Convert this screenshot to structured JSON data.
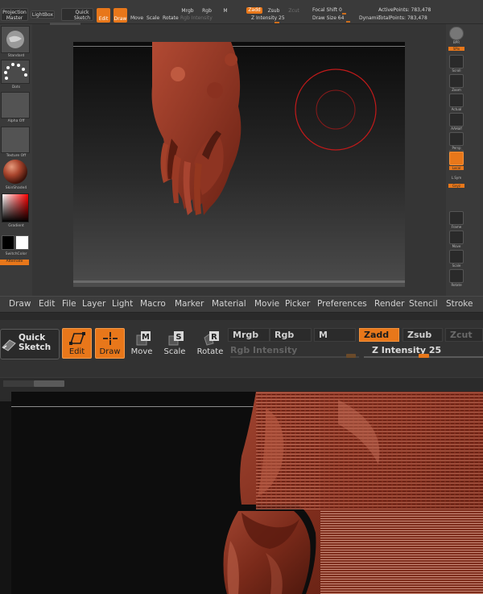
{
  "mini": {
    "toolbar": {
      "projection_master": "Projection Master",
      "lightbox": "LightBox",
      "quick_sketch": "Quick Sketch",
      "edit": "Edit",
      "draw": "Draw",
      "move": "Move",
      "scale": "Scale",
      "rotate": "Rotate",
      "mrgb": "Mrgb",
      "rgb": "Rgb",
      "m": "M",
      "rgb_intensity": "Rgb Intensity",
      "zadd": "Zadd",
      "zsub": "Zsub",
      "zcut": "Zcut",
      "z_intensity": "Z Intensity 25",
      "focal_shift": "Focal Shift 0",
      "draw_size": "Draw Size 64",
      "dynamic": "Dynamic",
      "active_points": "ActivePoints: 783,478",
      "total_points": "TotalPoints: 783,478"
    },
    "left": {
      "brush_label": "Standard",
      "stroke_label": "Dots",
      "alpha_label": "Alpha Off",
      "texture_label": "Texture Off",
      "material_label": "SkinShade4",
      "gradient_label": "Gradient",
      "switch_color": "SwitchColor",
      "alternate": "Alternate"
    },
    "right": {
      "buttons": [
        "BPR",
        "SPix",
        "Scroll",
        "Zoom",
        "Actual",
        "AAHalf",
        "Persp",
        "Floor",
        "Local",
        "L.Sym",
        "Gxyz",
        "Frame",
        "Move",
        "Scale",
        "Rotate"
      ]
    }
  },
  "menubar": {
    "items": [
      "Draw",
      "Edit",
      "File",
      "Layer",
      "Light",
      "Macro",
      "Marker",
      "Material",
      "Movie",
      "Picker",
      "Preferences",
      "Render",
      "Stencil",
      "Stroke"
    ]
  },
  "toolbar": {
    "quick_sketch": "Quick Sketch",
    "edit": "Edit",
    "draw": "Draw",
    "move": "Move",
    "scale": "Scale",
    "rotate": "Rotate",
    "mrgb": "Mrgb",
    "rgb": "Rgb",
    "m": "M",
    "zadd": "Zadd",
    "zsub": "Zsub",
    "zcut": "Zcut",
    "rgb_intensity": "Rgb Intensity",
    "z_intensity": "Z Intensity 25"
  },
  "colors": {
    "accent": "#e8771a",
    "model": "#8e3422",
    "ui_background": "#323232"
  }
}
